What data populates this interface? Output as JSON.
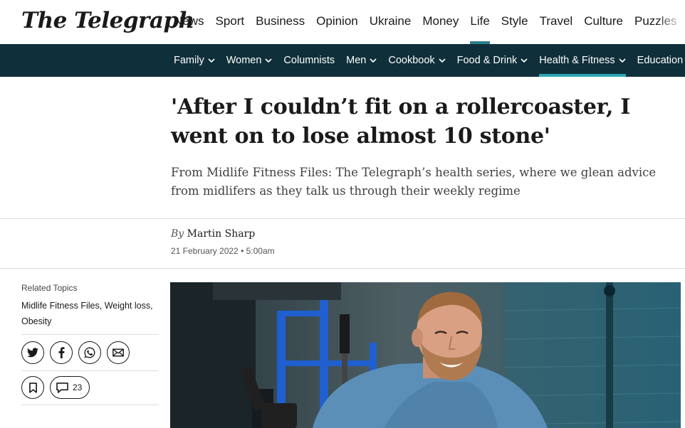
{
  "brand": {
    "name": "The Telegraph"
  },
  "topnav": [
    {
      "label": "News",
      "active": false
    },
    {
      "label": "Sport",
      "active": false
    },
    {
      "label": "Business",
      "active": false
    },
    {
      "label": "Opinion",
      "active": false
    },
    {
      "label": "Ukraine",
      "active": false
    },
    {
      "label": "Money",
      "active": false
    },
    {
      "label": "Life",
      "active": true
    },
    {
      "label": "Style",
      "active": false
    },
    {
      "label": "Travel",
      "active": false
    },
    {
      "label": "Culture",
      "active": false
    },
    {
      "label": "Puzzles",
      "active": false
    }
  ],
  "subnav": [
    {
      "label": "Family",
      "dropdown": true,
      "active": false
    },
    {
      "label": "Women",
      "dropdown": true,
      "active": false
    },
    {
      "label": "Columnists",
      "dropdown": false,
      "active": false
    },
    {
      "label": "Men",
      "dropdown": true,
      "active": false
    },
    {
      "label": "Cookbook",
      "dropdown": true,
      "active": false
    },
    {
      "label": "Food & Drink",
      "dropdown": true,
      "active": false
    },
    {
      "label": "Health & Fitness",
      "dropdown": true,
      "active": true
    },
    {
      "label": "Education",
      "dropdown": false,
      "active": false
    }
  ],
  "article": {
    "headline": "'After I couldn’t fit on a rollercoaster, I went on to lose almost 10 stone'",
    "standfirst": "From Midlife Fitness Files: The Telegraph’s health series, where we glean advice from midlifers as they talk us through their weekly regime",
    "byline_prefix": "By",
    "author": "Martin Sharp",
    "date": "21 February 2022 • 5:00am"
  },
  "sidebar": {
    "related_label": "Related Topics",
    "related_topics": "Midlife Fitness Files, Weight loss, Obesity",
    "comment_count": "23"
  },
  "share_icons": [
    "twitter-icon",
    "facebook-icon",
    "whatsapp-icon",
    "email-icon"
  ],
  "colors": {
    "accent": "#2f7e8c",
    "subnav_bg": "#0f2f3a",
    "subnav_accent": "#2fa6b5"
  }
}
